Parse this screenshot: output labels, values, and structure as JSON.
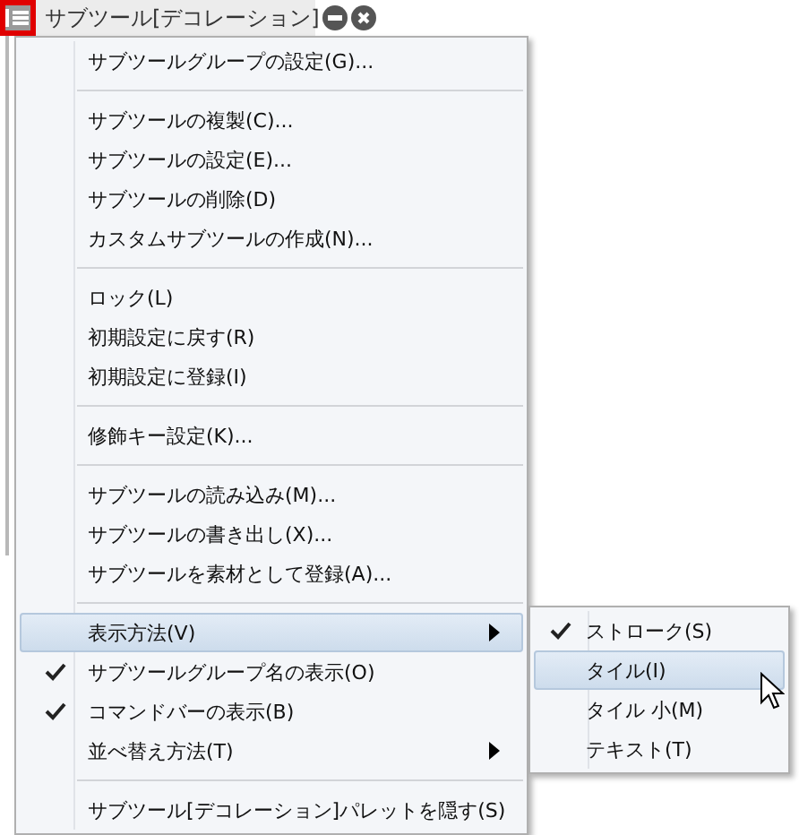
{
  "palette": {
    "title": "サブツール[デコレーション]"
  },
  "menu": [
    {
      "kind": "item",
      "label": "サブツールグループの設定(G)...",
      "checked": false,
      "selected": false,
      "has_submenu": false
    },
    {
      "kind": "separator"
    },
    {
      "kind": "item",
      "label": "サブツールの複製(C)...",
      "checked": false,
      "selected": false,
      "has_submenu": false
    },
    {
      "kind": "item",
      "label": "サブツールの設定(E)...",
      "checked": false,
      "selected": false,
      "has_submenu": false
    },
    {
      "kind": "item",
      "label": "サブツールの削除(D)",
      "checked": false,
      "selected": false,
      "has_submenu": false
    },
    {
      "kind": "item",
      "label": "カスタムサブツールの作成(N)...",
      "checked": false,
      "selected": false,
      "has_submenu": false
    },
    {
      "kind": "separator"
    },
    {
      "kind": "item",
      "label": "ロック(L)",
      "checked": false,
      "selected": false,
      "has_submenu": false
    },
    {
      "kind": "item",
      "label": "初期設定に戻す(R)",
      "checked": false,
      "selected": false,
      "has_submenu": false
    },
    {
      "kind": "item",
      "label": "初期設定に登録(I)",
      "checked": false,
      "selected": false,
      "has_submenu": false
    },
    {
      "kind": "separator"
    },
    {
      "kind": "item",
      "label": "修飾キー設定(K)...",
      "checked": false,
      "selected": false,
      "has_submenu": false
    },
    {
      "kind": "separator"
    },
    {
      "kind": "item",
      "label": "サブツールの読み込み(M)...",
      "checked": false,
      "selected": false,
      "has_submenu": false
    },
    {
      "kind": "item",
      "label": "サブツールの書き出し(X)...",
      "checked": false,
      "selected": false,
      "has_submenu": false
    },
    {
      "kind": "item",
      "label": "サブツールを素材として登録(A)...",
      "checked": false,
      "selected": false,
      "has_submenu": false
    },
    {
      "kind": "separator"
    },
    {
      "kind": "item",
      "label": "表示方法(V)",
      "checked": false,
      "selected": true,
      "has_submenu": true
    },
    {
      "kind": "item",
      "label": "サブツールグループ名の表示(O)",
      "checked": true,
      "selected": false,
      "has_submenu": false
    },
    {
      "kind": "item",
      "label": "コマンドバーの表示(B)",
      "checked": true,
      "selected": false,
      "has_submenu": false
    },
    {
      "kind": "item",
      "label": "並べ替え方法(T)",
      "checked": false,
      "selected": false,
      "has_submenu": true
    },
    {
      "kind": "separator"
    },
    {
      "kind": "item",
      "label": "サブツール[デコレーション]パレットを隠す(S)",
      "checked": false,
      "selected": false,
      "has_submenu": false
    }
  ],
  "submenu": [
    {
      "label": "ストローク(S)",
      "checked": true,
      "selected": false
    },
    {
      "label": "タイル(I)",
      "checked": false,
      "selected": true
    },
    {
      "label": "タイル 小(M)",
      "checked": false,
      "selected": false
    },
    {
      "label": "テキスト(T)",
      "checked": false,
      "selected": false
    }
  ]
}
